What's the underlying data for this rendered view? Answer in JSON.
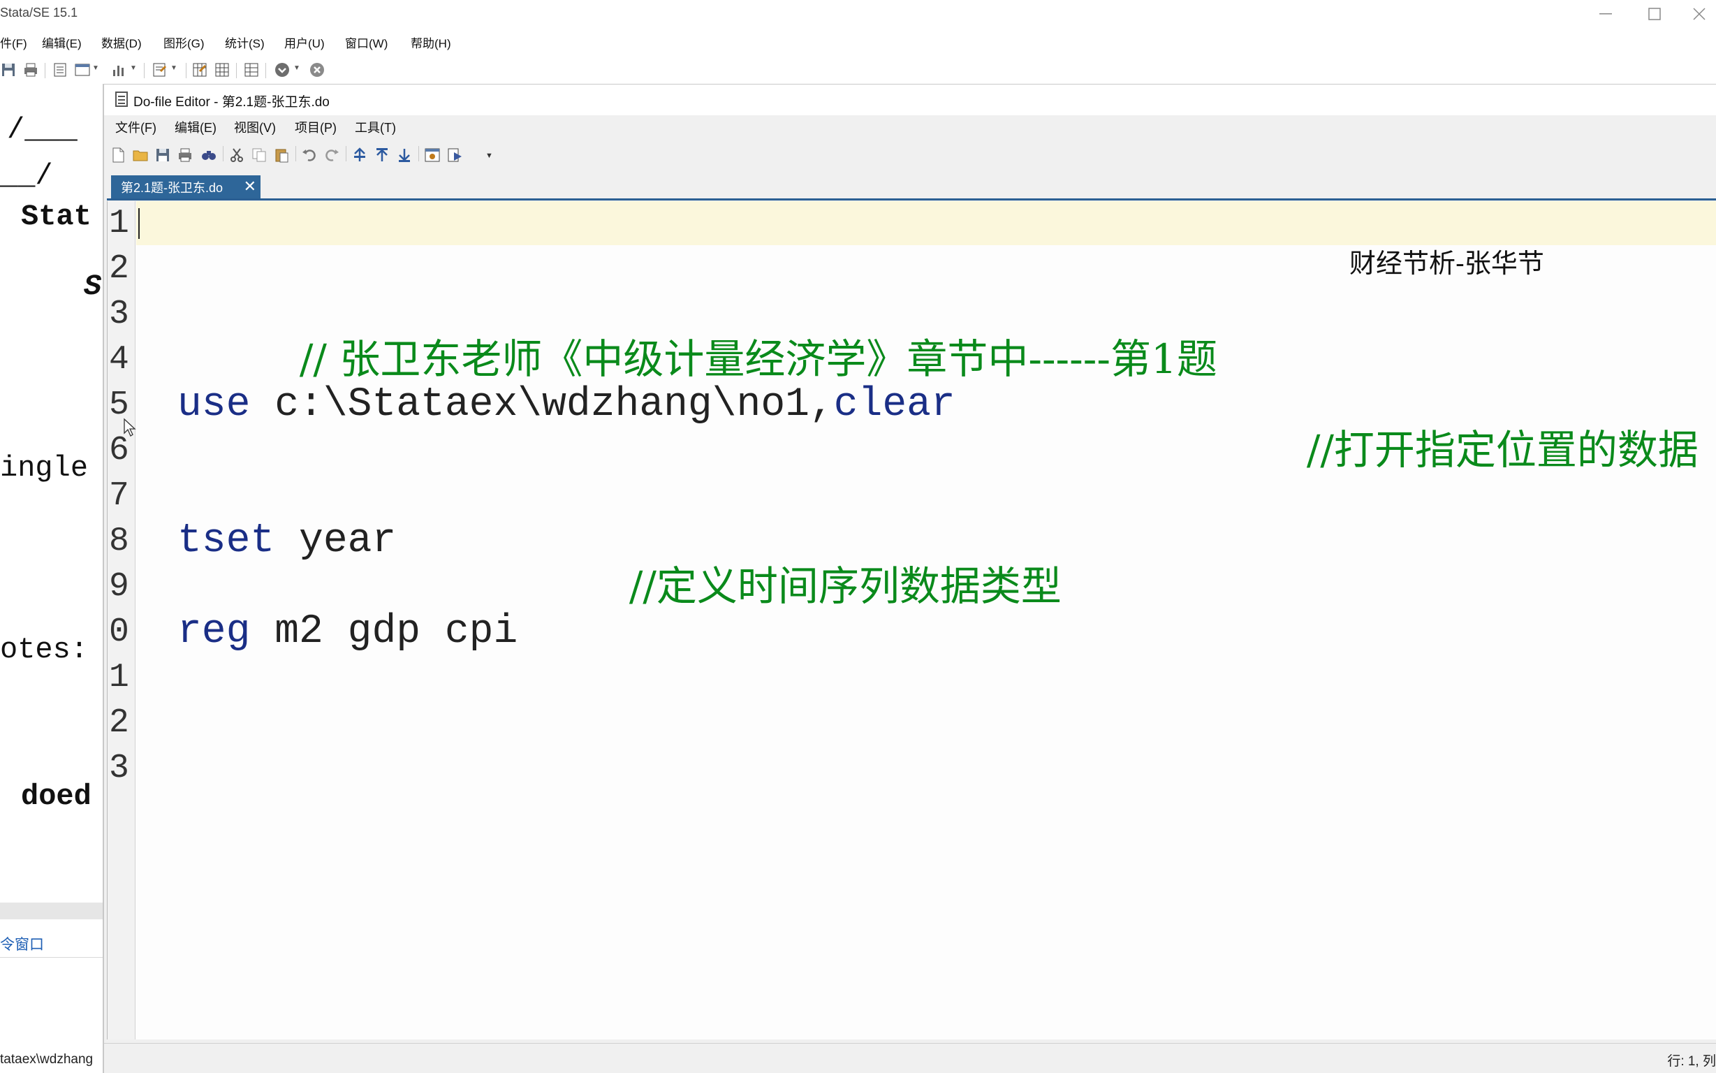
{
  "main_window": {
    "title": "Stata/SE 15.1",
    "menu": [
      "件(F)",
      "编辑(E)",
      "数据(D)",
      "图形(G)",
      "统计(S)",
      "用户(U)",
      "窗口(W)",
      "帮助(H)"
    ]
  },
  "results": {
    "logo_top": "/___",
    "logo_bottom": "__/",
    "lines": [
      "Stat",
      "S",
      "ingle",
      "otes:",
      "doed"
    ]
  },
  "command_window": {
    "label": "令窗口"
  },
  "status_bar": {
    "path": "tataex\\wdzhang"
  },
  "editor": {
    "title": "Do-file Editor - 第2.1题-张卫东.do",
    "menu": [
      "文件(F)",
      "编辑(E)",
      "视图(V)",
      "项目(P)",
      "工具(T)"
    ],
    "tab_label": "第2.1题-张卫东.do",
    "tab_close": "✕",
    "watermark": "财经节析-张华节",
    "line_numbers": [
      "1",
      "2",
      "3",
      "4",
      "5",
      "6",
      "7",
      "8",
      "9",
      "0",
      "1",
      "2",
      "3"
    ],
    "code": {
      "line3_comment": "// 张卫东老师《中级计量经济学》章节中------第1题",
      "line5_cmd": "use",
      "line5_args": " c:\\Stataex\\wdzhang\\no1,",
      "line5_opt": "clear",
      "line5_comment": "//打开指定位置的数据",
      "line8_cmd": "tset",
      "line8_args": " year",
      "line8_comment": "//定义时间序列数据类型",
      "line10_cmd": "reg",
      "line10_args": " m2 gdp cpi"
    },
    "status_position": "行: 1, 列"
  },
  "colors": {
    "keyword": "#1a2e86",
    "comment": "#0a8a1b",
    "tab_active": "#2e6699",
    "current_line": "#fbf7dc"
  }
}
